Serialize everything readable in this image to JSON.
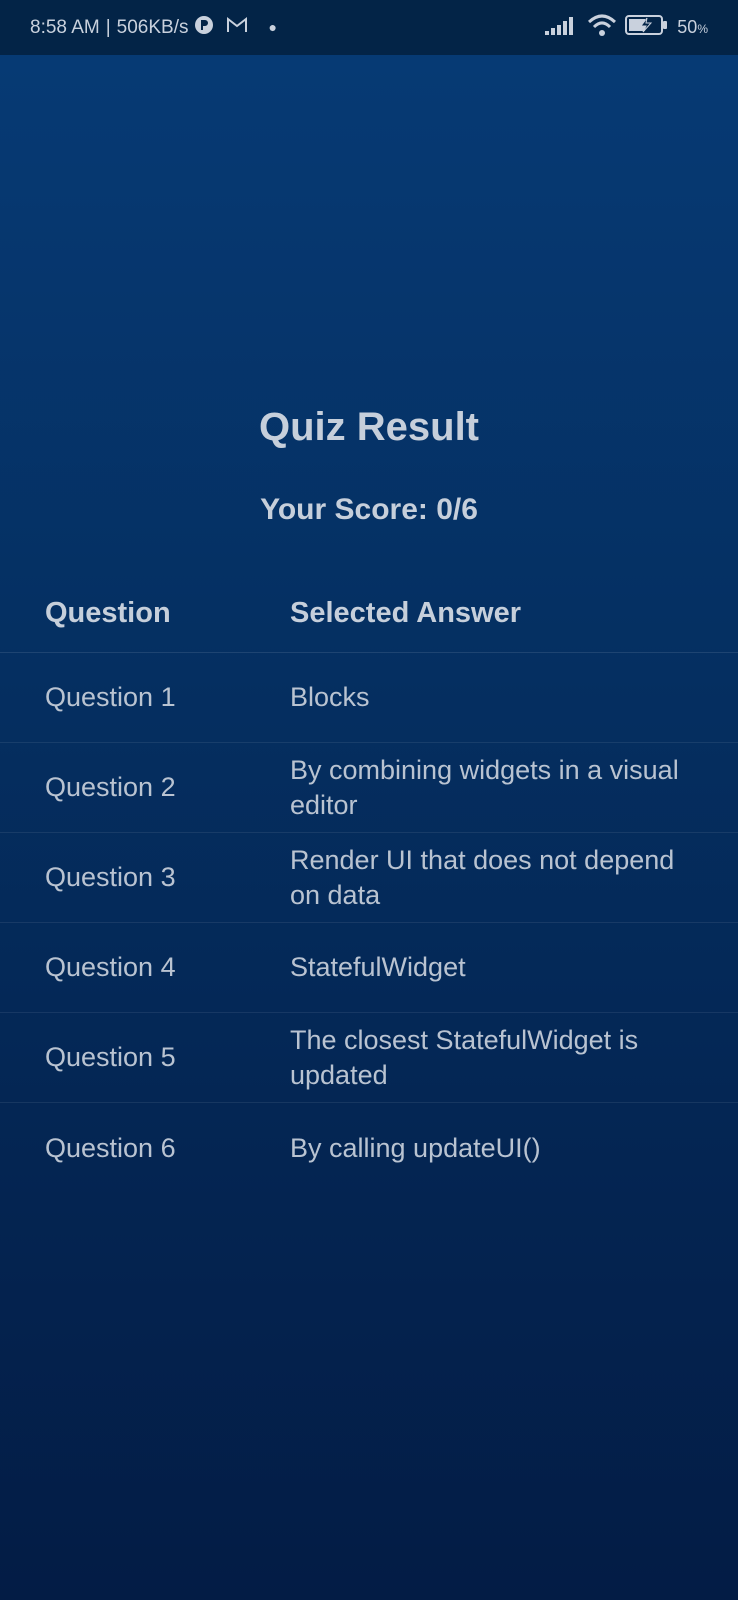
{
  "status_bar": {
    "time": "8:58 AM",
    "separator": "|",
    "speed": "506KB/s",
    "battery_percent": "50",
    "battery_unit": "%",
    "icons": [
      "app-circle-icon",
      "gmail-icon",
      "dot-icon",
      "signal-icon",
      "wifi-icon",
      "battery-charging-icon"
    ]
  },
  "quiz": {
    "title": "Quiz Result",
    "score": "Your Score: 0/6"
  },
  "table": {
    "headers": [
      "Question",
      "Selected Answer"
    ],
    "rows": [
      {
        "question": "Question 1",
        "answer": "Blocks"
      },
      {
        "question": "Question 2",
        "answer": "By combining widgets in a visual editor"
      },
      {
        "question": "Question 3",
        "answer": "Render UI that does not depend on data"
      },
      {
        "question": "Question 4",
        "answer": "StatefulWidget"
      },
      {
        "question": "Question 5",
        "answer": "The closest StatefulWidget is updated"
      },
      {
        "question": "Question 6",
        "answer": "By calling updateUI()"
      }
    ]
  },
  "colors": {
    "background_top": "#063a74",
    "background_bottom": "#031c45",
    "text": "#c6cfdb"
  }
}
